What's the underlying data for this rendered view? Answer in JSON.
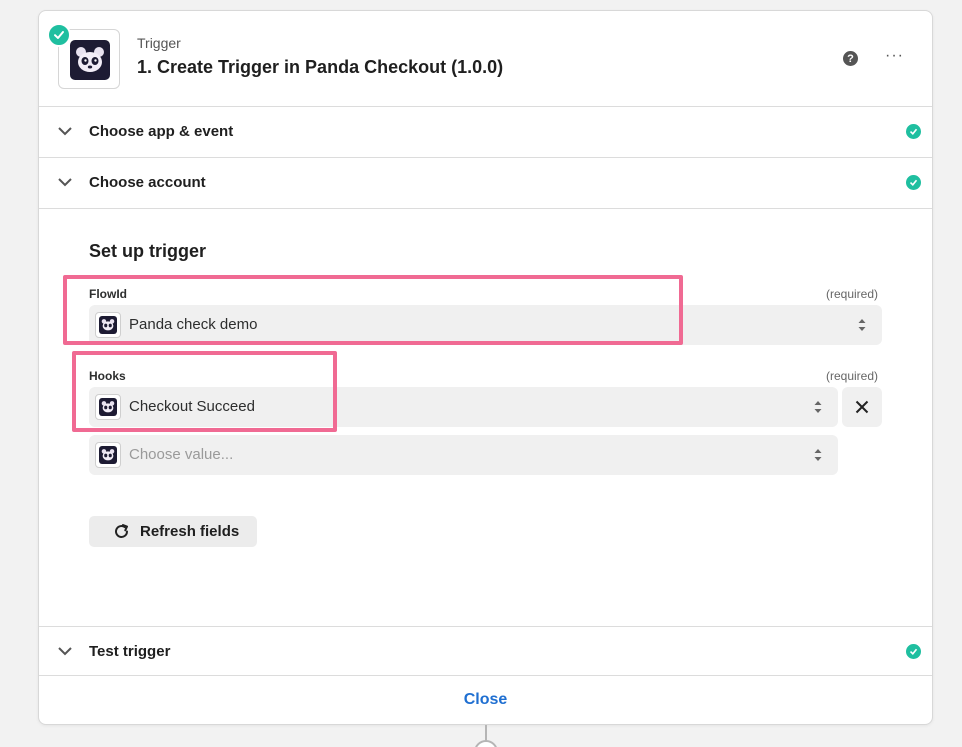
{
  "header": {
    "label": "Trigger",
    "title": "1. Create Trigger in Panda Checkout (1.0.0)",
    "help_icon": "?",
    "more_icon": "···"
  },
  "sections": {
    "app_event": {
      "label": "Choose app & event",
      "status": "complete"
    },
    "account": {
      "label": "Choose account",
      "status": "complete"
    },
    "test": {
      "label": "Test trigger",
      "status": "complete"
    }
  },
  "setup": {
    "title": "Set up trigger",
    "flowid": {
      "label": "FlowId",
      "required": "(required)",
      "value": "Panda check demo"
    },
    "hooks": {
      "label": "Hooks",
      "required": "(required)",
      "value": "Checkout Succeed",
      "placeholder": "Choose value..."
    },
    "refresh_label": "Refresh fields"
  },
  "footer": {
    "close_label": "Close"
  },
  "colors": {
    "accent_link": "#1f6fd1",
    "success": "#1fbfa0",
    "highlight": "#f06a93",
    "app_icon_bg": "#1d1b33"
  }
}
